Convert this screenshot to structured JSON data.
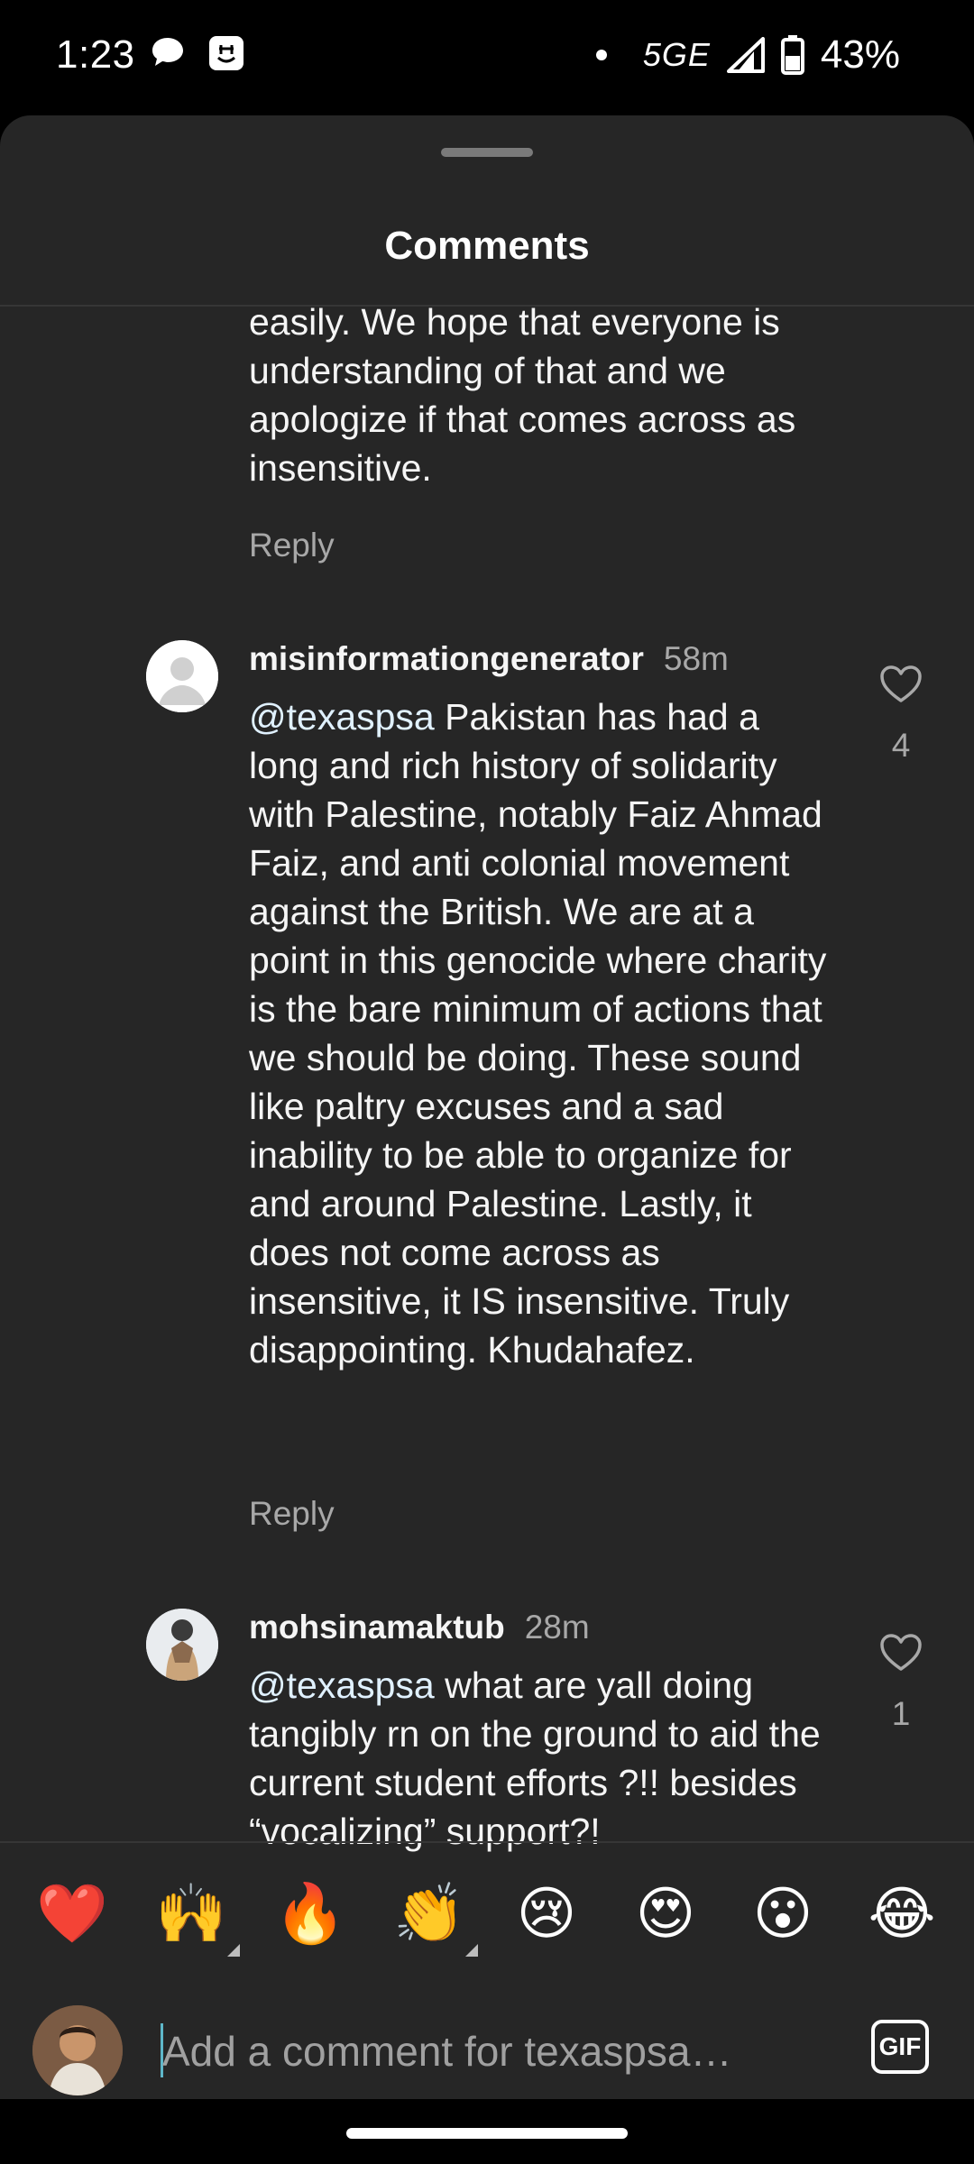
{
  "status_bar": {
    "time": "1:23",
    "network": "5GE",
    "battery": "43%",
    "icons": [
      "chat-bubble-icon",
      "app-icon",
      "dot-icon",
      "signal-icon",
      "battery-icon"
    ]
  },
  "sheet": {
    "title": "Comments"
  },
  "comments": [
    {
      "text": "easily. We hope that everyone is understanding of that and we apologize if that comes across as insensitive.",
      "reply_label": "Reply"
    },
    {
      "username": "misinformationgenerator",
      "time": "58m",
      "mention": "@texaspsa",
      "text": " Pakistan has had a long and rich history of solidarity with Palestine, notably Faiz Ahmad Faiz, and anti colonial movement against the British. We are at a point in this genocide where charity is the bare minimum of actions that we should be doing. These sound like paltry excuses and a sad inability to be able to organize for and around Palestine. Lastly, it does not come across as insensitive, it IS insensitive. Truly disappointing. Khudahafez.",
      "likes": "4",
      "reply_label": "Reply"
    },
    {
      "username": "mohsinamaktub",
      "time": "28m",
      "mention": "@texaspsa",
      "text": " what are yall doing tangibly rn on the ground to aid the current student efforts ?!! besides “vocalizing” support?!",
      "likes": "1"
    }
  ],
  "emoji_bar": {
    "items": [
      "❤️",
      "🙌",
      "🔥",
      "👏",
      "😢",
      "😍",
      "😮",
      "😂"
    ]
  },
  "composer": {
    "placeholder": "Add a comment for texaspsa…",
    "gif_label": "GIF"
  },
  "colors": {
    "sheet_bg": "#262626",
    "mention": "#e0f1ff",
    "secondary_text": "#a8a8a8"
  }
}
